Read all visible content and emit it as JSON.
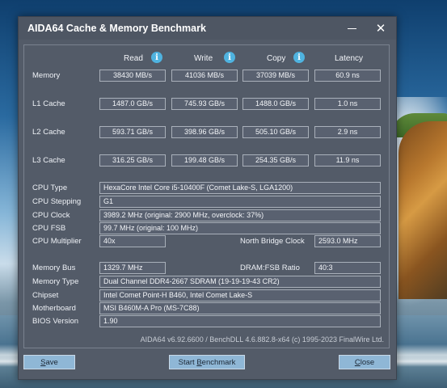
{
  "window": {
    "title": "AIDA64 Cache & Memory Benchmark",
    "minimize_icon": "minimize-icon",
    "close_icon": "close-x-icon",
    "close_glyph": "✕"
  },
  "columns": {
    "read": "Read",
    "write": "Write",
    "copy": "Copy",
    "latency": "Latency",
    "info_icon_glyph": "i",
    "info_icon_color": "#4fb3e0"
  },
  "benchmark_rows": [
    {
      "label": "Memory",
      "read": "38430 MB/s",
      "write": "41036 MB/s",
      "copy": "37039 MB/s",
      "latency": "60.9 ns"
    },
    {
      "label": "L1 Cache",
      "read": "1487.0 GB/s",
      "write": "745.93 GB/s",
      "copy": "1488.0 GB/s",
      "latency": "1.0 ns"
    },
    {
      "label": "L2 Cache",
      "read": "593.71 GB/s",
      "write": "398.96 GB/s",
      "copy": "505.10 GB/s",
      "latency": "2.9 ns"
    },
    {
      "label": "L3 Cache",
      "read": "316.25 GB/s",
      "write": "199.48 GB/s",
      "copy": "254.35 GB/s",
      "latency": "11.9 ns"
    }
  ],
  "cpu": {
    "type_label": "CPU Type",
    "type_value": "HexaCore Intel Core i5-10400F  (Comet Lake-S, LGA1200)",
    "stepping_label": "CPU Stepping",
    "stepping_value": "G1",
    "clock_label": "CPU Clock",
    "clock_value": "3989.2 MHz  (original: 2900 MHz, overclock: 37%)",
    "fsb_label": "CPU FSB",
    "fsb_value": "99.7 MHz  (original: 100 MHz)",
    "multiplier_label": "CPU Multiplier",
    "multiplier_value": "40x",
    "nb_clock_label": "North Bridge Clock",
    "nb_clock_value": "2593.0 MHz"
  },
  "memory": {
    "bus_label": "Memory Bus",
    "bus_value": "1329.7 MHz",
    "ratio_label": "DRAM:FSB Ratio",
    "ratio_value": "40:3",
    "type_label": "Memory Type",
    "type_value": "Dual Channel DDR4-2667 SDRAM  (19-19-19-43 CR2)",
    "chipset_label": "Chipset",
    "chipset_value": "Intel Comet Point-H B460, Intel Comet Lake-S",
    "motherboard_label": "Motherboard",
    "motherboard_value": "MSI B460M-A Pro (MS-7C88)",
    "bios_label": "BIOS Version",
    "bios_value": "1.90"
  },
  "footer": {
    "text": "AIDA64 v6.92.6600 / BenchDLL 4.6.882.8-x64  (c) 1995-2023 FinalWire Ltd."
  },
  "buttons": {
    "save_first": "S",
    "save_rest": "ave",
    "start_pre": "Start ",
    "start_u": "B",
    "start_rest": "enchmark",
    "close_first": "C",
    "close_rest": "lose"
  }
}
